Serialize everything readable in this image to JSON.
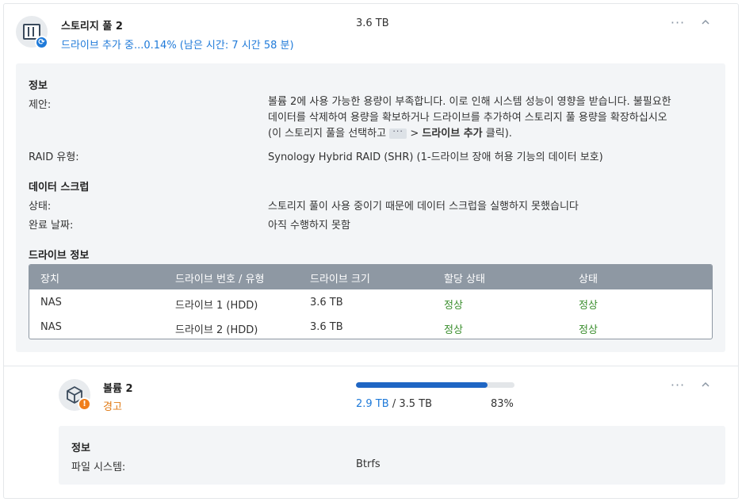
{
  "pool": {
    "title": "스토리지 풀 2",
    "status": "드라이브 추가 중...0.14% (남은 시간: 7 시간 58 분)",
    "size": "3.6 TB"
  },
  "pool_info": {
    "heading": "정보",
    "suggestion_label": "제안:",
    "suggestion_line1": "볼륨 2에 사용 가능한 용량이 부족합니다. 이로 인해 시스템 성능이 영향을 받습니다. 불필요한",
    "suggestion_line2": "데이터를 삭제하여 용량을 확보하거나 드라이브를 추가하여 스토리지 풀 용량을 확장하십시오",
    "suggestion_line3_pre": "(이 스토리지 풀을 선택하고",
    "suggestion_line3_arrow": ">",
    "suggestion_line3_bold": "드라이브 추가",
    "suggestion_line3_post": "클릭).",
    "raid_label": "RAID 유형:",
    "raid_value": "Synology Hybrid RAID (SHR) (1-드라이브 장애 허용 기능의 데이터 보호)"
  },
  "scrub": {
    "heading": "데이터 스크럽",
    "status_label": "상태:",
    "status_value": "스토리지 풀이 사용 중이기 때문에 데이터 스크럽을 실행하지 못했습니다",
    "completed_label": "완료 날짜:",
    "completed_value": "아직 수행하지 못함"
  },
  "drives": {
    "heading": "드라이브 정보",
    "columns": [
      "장치",
      "드라이브 번호 / 유형",
      "드라이브 크기",
      "할당 상태",
      "상태"
    ],
    "rows": [
      [
        "NAS",
        "드라이브 1 (HDD)",
        "3.6 TB",
        "정상",
        "정상"
      ],
      [
        "NAS",
        "드라이브 2 (HDD)",
        "3.6 TB",
        "정상",
        "정상"
      ]
    ]
  },
  "volume": {
    "title": "볼륨 2",
    "status": "경고",
    "used": "2.9 TB",
    "separator": "/",
    "total": "3.5 TB",
    "percent": "83%",
    "usage_fraction": 0.83
  },
  "volume_info": {
    "heading": "정보",
    "fs_label": "파일 시스템:",
    "fs_value": "Btrfs"
  },
  "icons": {
    "pool": "storage-pool-icon",
    "sync": "sync-icon",
    "volume": "volume-cube-icon",
    "warning": "warning-icon",
    "more": "more-options-icon",
    "collapse": "chevron-up-icon"
  },
  "colors": {
    "accent": "#1f7ad9",
    "warning": "#e07a14",
    "healthy": "#3a8e2d",
    "table_header": "#8e98a3"
  }
}
